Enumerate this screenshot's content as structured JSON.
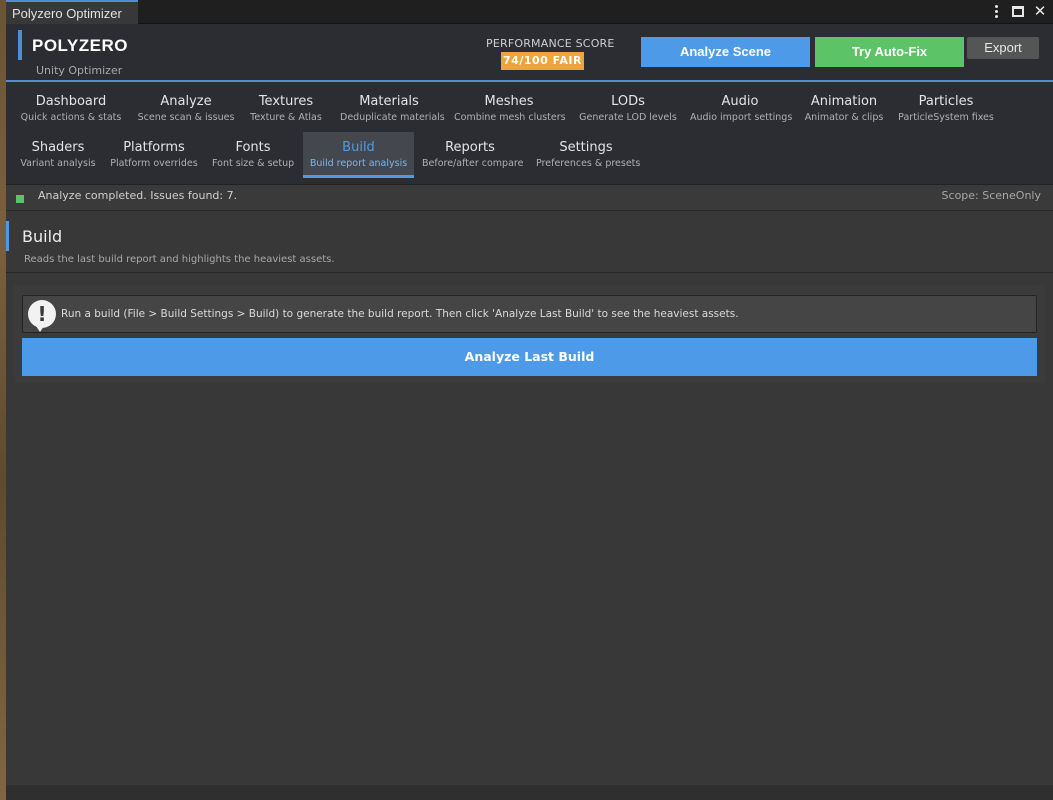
{
  "window": {
    "tab_title": "Polyzero Optimizer"
  },
  "header": {
    "brand_title": "POLYZERO",
    "brand_subtitle": "Unity Optimizer",
    "performance_label": "PERFORMANCE SCORE",
    "performance_badge": "74/100 FAIR",
    "analyze_label": "Analyze Scene",
    "autofix_label": "Try Auto-Fix",
    "export_label": "Export",
    "colors": {
      "accent": "#4d9be8",
      "autofix": "#5cc467",
      "badge": "#f0a33a"
    }
  },
  "nav": {
    "row1": [
      {
        "title": "Dashboard",
        "subtitle": "Quick actions & stats"
      },
      {
        "title": "Analyze",
        "subtitle": "Scene scan & issues"
      },
      {
        "title": "Textures",
        "subtitle": "Texture & Atlas"
      },
      {
        "title": "Materials",
        "subtitle": "Deduplicate materials"
      },
      {
        "title": "Meshes",
        "subtitle": "Combine mesh clusters"
      },
      {
        "title": "LODs",
        "subtitle": "Generate LOD levels"
      },
      {
        "title": "Audio",
        "subtitle": "Audio import settings"
      },
      {
        "title": "Animation",
        "subtitle": "Animator & clips"
      },
      {
        "title": "Particles",
        "subtitle": "ParticleSystem fixes"
      }
    ],
    "row2": [
      {
        "title": "Shaders",
        "subtitle": "Variant analysis"
      },
      {
        "title": "Platforms",
        "subtitle": "Platform overrides"
      },
      {
        "title": "Fonts",
        "subtitle": "Font size & setup"
      },
      {
        "title": "Build",
        "subtitle": "Build report analysis"
      },
      {
        "title": "Reports",
        "subtitle": "Before/after compare"
      },
      {
        "title": "Settings",
        "subtitle": "Preferences & presets"
      }
    ],
    "active": "Build"
  },
  "status": {
    "message": "Analyze completed. Issues found: 7.",
    "scope": "Scope: SceneOnly"
  },
  "section": {
    "title": "Build",
    "description": "Reads the last build report and highlights the heaviest assets."
  },
  "content": {
    "help_icon": "!",
    "help_text": "Run a build (File > Build Settings > Build) to generate the build report. Then click 'Analyze Last Build' to see the heaviest assets.",
    "analyze_build_label": "Analyze Last Build"
  }
}
